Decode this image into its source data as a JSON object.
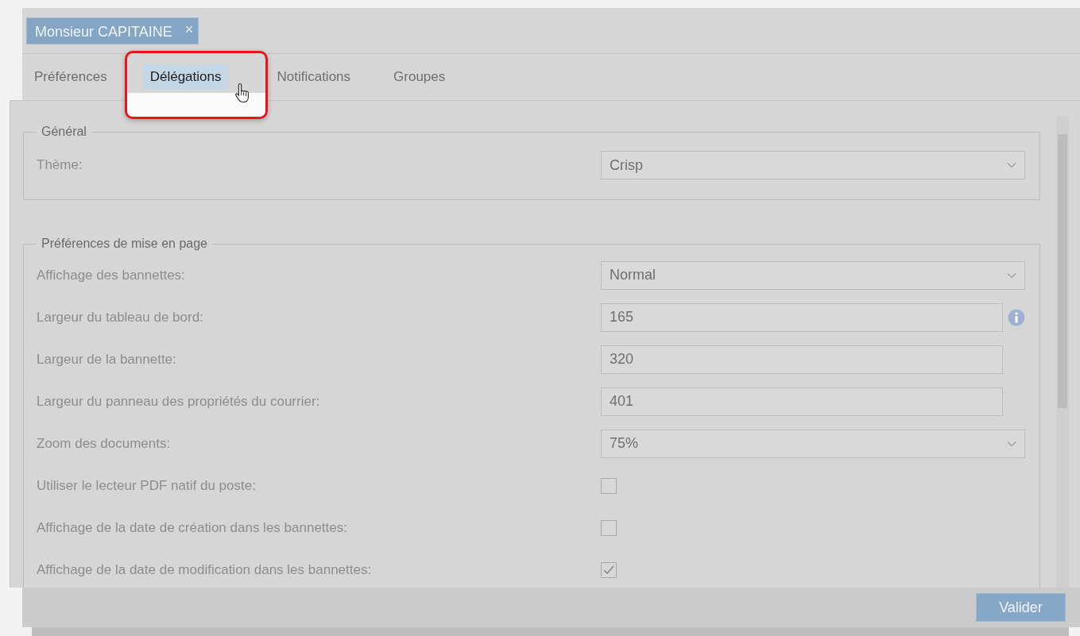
{
  "user_tab": {
    "label": "Monsieur CAPITAINE",
    "close": "×"
  },
  "tabs": [
    {
      "label": "Préférences",
      "selected": false
    },
    {
      "label": "Délégations",
      "selected": true
    },
    {
      "label": "Notifications",
      "selected": false
    },
    {
      "label": "Groupes",
      "selected": false
    }
  ],
  "sections": [
    {
      "title": "Général",
      "fields": [
        {
          "kind": "select",
          "label": "Thème:",
          "value": "Crisp"
        }
      ]
    },
    {
      "title": "Préférences de mise en page",
      "fields": [
        {
          "kind": "select",
          "label": "Affichage des bannettes:",
          "value": "Normal"
        },
        {
          "kind": "text",
          "label": "Largeur du tableau de bord:",
          "value": "165",
          "info": true
        },
        {
          "kind": "text",
          "label": "Largeur de la bannette:",
          "value": "320"
        },
        {
          "kind": "text",
          "label": "Largeur du panneau des propriétés du courrier:",
          "value": "401"
        },
        {
          "kind": "select",
          "label": "Zoom des documents:",
          "value": "75%"
        },
        {
          "kind": "checkbox",
          "label": "Utiliser le lecteur PDF natif du poste:",
          "checked": false
        },
        {
          "kind": "checkbox",
          "label": "Affichage de la date de création dans les bannettes:",
          "checked": false
        },
        {
          "kind": "checkbox",
          "label": "Affichage de la date de modification dans les bannettes:",
          "checked": true
        }
      ]
    }
  ],
  "submit": "Valider"
}
